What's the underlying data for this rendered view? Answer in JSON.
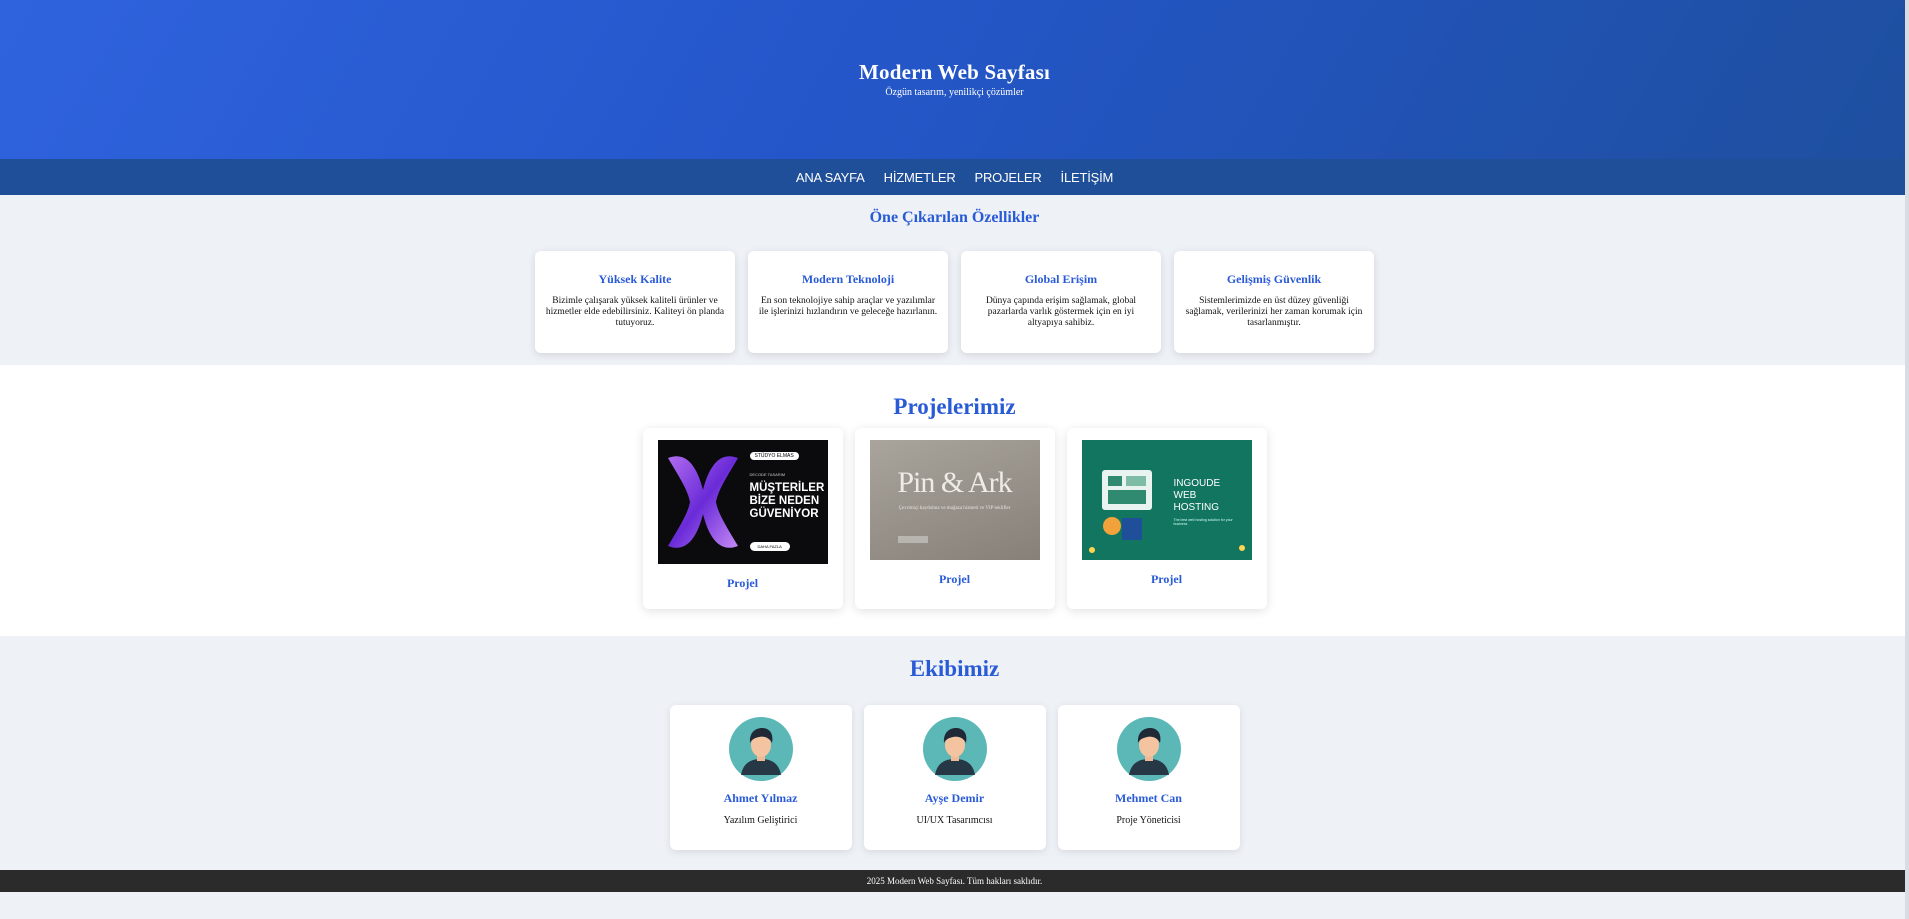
{
  "hero": {
    "title": "Modern Web Sayfası",
    "subtitle": "Özgün tasarım, yenilikçi çözümler"
  },
  "nav": {
    "items": [
      "ANA SAYFA",
      "HİZMETLER",
      "PROJELER",
      "İLETİŞİM"
    ]
  },
  "features": {
    "title": "Öne Çıkarılan Özellikler",
    "cards": [
      {
        "title": "Yüksek Kalite",
        "text": "Bizimle çalışarak yüksek kaliteli ürünler ve hizmetler elde edebilirsiniz. Kaliteyi ön planda tutuyoruz."
      },
      {
        "title": "Modern Teknoloji",
        "text": "En son teknolojiye sahip araçlar ve yazılımlar ile işlerinizi hızlandırın ve geleceğe hazırlanın."
      },
      {
        "title": "Global Erişim",
        "text": "Dünya çapında erişim sağlamak, global pazarlarda varlık göstermek için en iyi altyapıya sahibiz."
      },
      {
        "title": "Gelişmiş Güvenlik",
        "text": "Sistemlerimizde en üst düzey güvenliği sağlamak, verilerinizi her zaman korumak için tasarlanmıştır."
      }
    ]
  },
  "projects": {
    "title": "Projelerimiz",
    "cards": [
      {
        "label": "Projel",
        "thumb": {
          "tag": "STÜDYO ELMAS",
          "small": "DECODE TASARIM",
          "headline": "MÜŞTERİLER BİZE NEDEN GÜVENİYOR",
          "button": "DAHA FAZLA"
        }
      },
      {
        "label": "Projel",
        "thumb": {
          "logo": "Pin & Ark",
          "sub": "Çevrimiçi kaydolma ve mağaza hizmeti ve VIP teklifler"
        }
      },
      {
        "label": "Projel",
        "thumb": {
          "headline": "INGOUDE WEB HOSTING",
          "small": "The best web hosting solution for your business"
        }
      }
    ]
  },
  "team": {
    "title": "Ekibimiz",
    "members": [
      {
        "name": "Ahmet Yılmaz",
        "role": "Yazılım Geliştirici"
      },
      {
        "name": "Ayşe Demir",
        "role": "UI/UX Tasarımcısı"
      },
      {
        "name": "Mehmet Can",
        "role": "Proje Yöneticisi"
      }
    ]
  },
  "footer": {
    "text": "2025 Modern Web Sayfası. Tüm hakları saklıdır."
  },
  "colors": {
    "primary": "#2a5bd6",
    "nav_bg": "#1f4f98",
    "footer_bg": "#2b2b2b",
    "avatar_bg": "#5bb8b7"
  }
}
